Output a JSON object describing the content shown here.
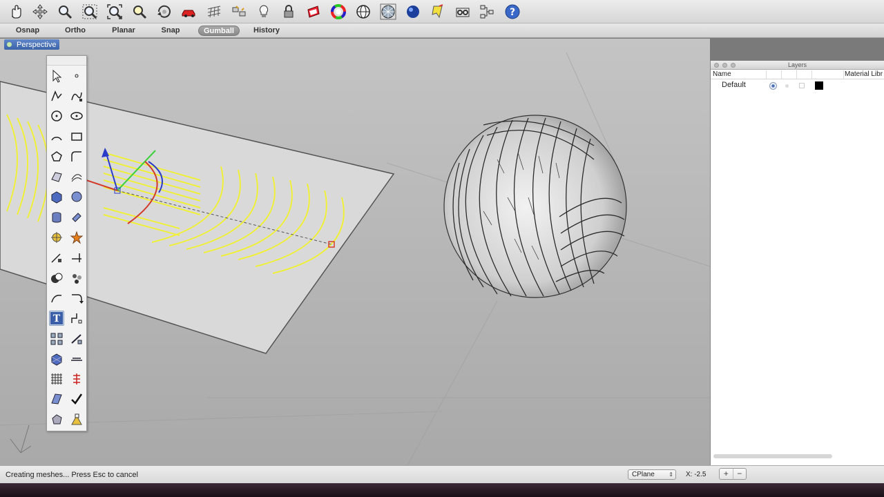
{
  "toolbar": {
    "icons": [
      "hand-pan-icon",
      "move-arrows-icon",
      "zoom-icon",
      "zoom-window-icon",
      "zoom-extents-icon",
      "zoom-selected-icon",
      "rotate-view-icon",
      "car-icon",
      "grid-icon",
      "named-views-icon",
      "lightbulb-icon",
      "lock-icon",
      "layer-icon",
      "color-wheel-icon",
      "globe-wireframe-icon",
      "render-mesh-icon",
      "sphere-render-icon",
      "bookmark-icon",
      "gear-puzzle-icon",
      "network-icon",
      "help-icon"
    ]
  },
  "mode_bar": {
    "items": [
      {
        "label": "Osnap",
        "active": false
      },
      {
        "label": "Ortho",
        "active": false
      },
      {
        "label": "Planar",
        "active": false
      },
      {
        "label": "Snap",
        "active": false
      },
      {
        "label": "Gumball",
        "active": true
      },
      {
        "label": "History",
        "active": false
      }
    ]
  },
  "viewport": {
    "tab_label": "Perspective"
  },
  "palette": {
    "rows": [
      [
        "select-arrow-icon",
        "point-icon"
      ],
      [
        "polyline-icon",
        "curve-icon"
      ],
      [
        "circle-icon",
        "ellipse-icon"
      ],
      [
        "arc-icon",
        "rectangle-icon"
      ],
      [
        "polygon-icon",
        "fillet-icon"
      ],
      [
        "surface-icon",
        "loft-icon"
      ],
      [
        "box-solid-icon",
        "sphere-icon"
      ],
      [
        "cylinder-icon",
        "extrude-icon"
      ],
      [
        "transform-icon",
        "explode-icon"
      ],
      [
        "trim-icon",
        "split-icon"
      ],
      [
        "boolean-icon",
        "analysis-icon"
      ],
      [
        "curve-offset-icon",
        "sweep-icon"
      ],
      [
        "text-icon",
        "dimension-icon"
      ],
      [
        "array-icon",
        "edit-points-icon"
      ],
      [
        "mesh-icon",
        "section-icon"
      ],
      [
        "grid-array-icon",
        "contour-icon"
      ],
      [
        "solid-edit-icon",
        "check-icon"
      ],
      [
        "render-solid-icon",
        "material-icon"
      ]
    ]
  },
  "layers": {
    "panel_title": "Layers",
    "tab_material": "Material Libr",
    "column_name": "Name",
    "rows": [
      {
        "name": "Default",
        "color": "#000000"
      }
    ]
  },
  "status": {
    "text": "Creating meshes... Press Esc to cancel",
    "cplane": "CPlane",
    "coord": "X: -2.5",
    "add_label": "+",
    "remove_label": "−"
  },
  "colors": {
    "selection": "#f5f53a",
    "viewport_bg": "#8f8f8f",
    "active_tab": "#4a73b8"
  }
}
